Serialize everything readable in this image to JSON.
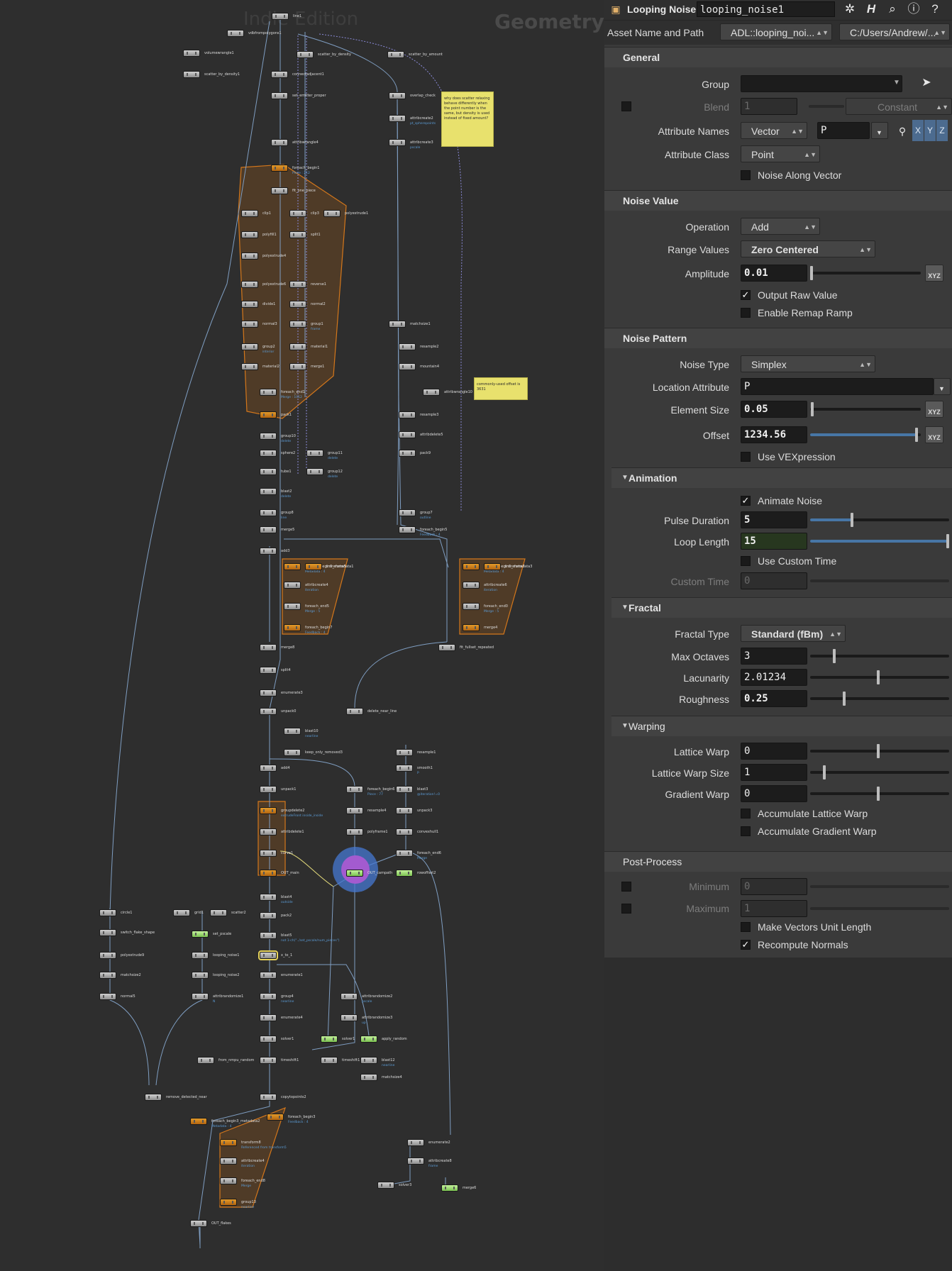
{
  "network": {
    "context_label": "Indie Edition",
    "geometry_label": "Geometry",
    "sticky_notes": [
      "why does scatter relaxing behave differently when the point number is the same, but density is used instead of fixed amount?",
      "commonly-used offset is 3631"
    ],
    "nodes": [
      {
        "label": "line1",
        "sub": ""
      },
      {
        "label": "vdbfrompolygons1",
        "sub": ""
      },
      {
        "label": "volumewrangle1",
        "sub": ""
      },
      {
        "label": "scatter_by_density1",
        "sub": ""
      },
      {
        "label": "scatter_by_density",
        "sub": ""
      },
      {
        "label": "scatter_by_amount",
        "sub": ""
      },
      {
        "label": "connectadjacent1",
        "sub": ""
      },
      {
        "label": "set_emitter_proper",
        "sub": ""
      },
      {
        "label": "overlap_check",
        "sub": ""
      },
      {
        "label": "attribcreate2",
        "sub": "pt_spherepoints"
      },
      {
        "label": "attribcreate3",
        "sub": "pscale"
      },
      {
        "label": "attribwrangle4",
        "sub": ""
      },
      {
        "label": "foreach_begin1",
        "sub": "Piece : 212"
      },
      {
        "label": "fit_one_piece",
        "sub": ""
      },
      {
        "label": "clip1",
        "sub": ""
      },
      {
        "label": "clip3",
        "sub": ""
      },
      {
        "label": "polyextrude1",
        "sub": ""
      },
      {
        "label": "polyfill1",
        "sub": ""
      },
      {
        "label": "split1",
        "sub": ""
      },
      {
        "label": "polyextrude4",
        "sub": ""
      },
      {
        "label": "polyextrude6",
        "sub": ""
      },
      {
        "label": "reverse1",
        "sub": ""
      },
      {
        "label": "divide1",
        "sub": ""
      },
      {
        "label": "normal2",
        "sub": ""
      },
      {
        "label": "normal3",
        "sub": ""
      },
      {
        "label": "group1",
        "sub": "frame"
      },
      {
        "label": "group2",
        "sub": "interior"
      },
      {
        "label": "material1",
        "sub": ""
      },
      {
        "label": "material2",
        "sub": ""
      },
      {
        "label": "merge1",
        "sub": ""
      },
      {
        "label": "foreach_end1",
        "sub": "Merge : 1012"
      },
      {
        "label": "pack1",
        "sub": ""
      },
      {
        "label": "group10",
        "sub": "delete"
      },
      {
        "label": "sphere2",
        "sub": ""
      },
      {
        "label": "group11",
        "sub": "delete"
      },
      {
        "label": "tube1",
        "sub": ""
      },
      {
        "label": "group12",
        "sub": "delete"
      },
      {
        "label": "blast2",
        "sub": "delete"
      },
      {
        "label": "group8",
        "sub": "line"
      },
      {
        "label": "merge5",
        "sub": ""
      },
      {
        "label": "add3",
        "sub": ""
      },
      {
        "label": "matchsize1",
        "sub": ""
      },
      {
        "label": "resample2",
        "sub": ""
      },
      {
        "label": "mountain4",
        "sub": ""
      },
      {
        "label": "attribwrangle10",
        "sub": ""
      },
      {
        "label": "resample3",
        "sub": ""
      },
      {
        "label": "attribdelete5",
        "sub": ""
      },
      {
        "label": "pack9",
        "sub": ""
      },
      {
        "label": "group7",
        "sub": "outline"
      },
      {
        "label": "foreach_begin5",
        "sub": "Feedback : 4"
      },
      {
        "label": "foreach_begin5_metadata1",
        "sub": "Metadata : 4"
      },
      {
        "label": "transform5",
        "sub": ""
      },
      {
        "label": "attribcreate4",
        "sub": "iteration"
      },
      {
        "label": "foreach_end5",
        "sub": "Merge : 5"
      },
      {
        "label": "foreach_begin7",
        "sub": "Feedback : 4"
      },
      {
        "label": "foreach_begin5_metadata3",
        "sub": "Metadata : 4"
      },
      {
        "label": "transform7",
        "sub": ""
      },
      {
        "label": "attribcreate6",
        "sub": "iteration"
      },
      {
        "label": "foreach_end0",
        "sub": "Merge : 5"
      },
      {
        "label": "merge4",
        "sub": ""
      },
      {
        "label": "merge8",
        "sub": ""
      },
      {
        "label": "fit_fullset_repeated",
        "sub": ""
      },
      {
        "label": "split4",
        "sub": ""
      },
      {
        "label": "enumerate3",
        "sub": ""
      },
      {
        "label": "unpack0",
        "sub": ""
      },
      {
        "label": "delete_near_line",
        "sub": ""
      },
      {
        "label": "blast10",
        "sub": "nearline"
      },
      {
        "label": "keep_only_removed3",
        "sub": ""
      },
      {
        "label": "add4",
        "sub": ""
      },
      {
        "label": "resample1",
        "sub": ""
      },
      {
        "label": "smooth1",
        "sub": "P"
      },
      {
        "label": "blast3",
        "sub": "@iteration!=0"
      },
      {
        "label": "unpack1",
        "sub": ""
      },
      {
        "label": "foreach_begin6",
        "sub": "Piece : 77"
      },
      {
        "label": "groupdelete2",
        "sub": "extrudeFront inside_inside"
      },
      {
        "label": "resample4",
        "sub": ""
      },
      {
        "label": "unpack3",
        "sub": ""
      },
      {
        "label": "attribdelete1",
        "sub": ""
      },
      {
        "label": "polyframe1",
        "sub": ""
      },
      {
        "label": "convexhull1",
        "sub": ""
      },
      {
        "label": "curve1",
        "sub": ""
      },
      {
        "label": "foreach_end6",
        "sub": "Merge"
      },
      {
        "label": "OUT_main",
        "sub": ""
      },
      {
        "label": "OUT_campath",
        "sub": ""
      },
      {
        "label": "rowoffset2",
        "sub": ""
      },
      {
        "label": "blast4",
        "sub": "outside"
      },
      {
        "label": "circle1",
        "sub": ""
      },
      {
        "label": "grid1",
        "sub": ""
      },
      {
        "label": "scatter2",
        "sub": ""
      },
      {
        "label": "pack2",
        "sub": ""
      },
      {
        "label": "switch_flake_shape",
        "sub": ""
      },
      {
        "label": "set_pscale",
        "sub": ""
      },
      {
        "label": "blast5",
        "sub": "not 1-ch(\"../set_pscale/num_pieces\")"
      },
      {
        "label": "polyextrude9",
        "sub": ""
      },
      {
        "label": "looping_noise1",
        "sub": ""
      },
      {
        "label": "x_to_1",
        "sub": ""
      },
      {
        "label": "matchsize2",
        "sub": ""
      },
      {
        "label": "looping_noise2",
        "sub": ""
      },
      {
        "label": "enumerate1",
        "sub": ""
      },
      {
        "label": "normal5",
        "sub": ""
      },
      {
        "label": "attribrandomize1",
        "sub": "N"
      },
      {
        "label": "group4",
        "sub": "nearline"
      },
      {
        "label": "attribrandomize2",
        "sub": "pscale"
      },
      {
        "label": "enumerate4",
        "sub": ""
      },
      {
        "label": "attribrandomize3",
        "sub": "up"
      },
      {
        "label": "solver1",
        "sub": ""
      },
      {
        "label": "solver1",
        "sub": ""
      },
      {
        "label": "apply_random",
        "sub": ""
      },
      {
        "label": "from_nmpu_random",
        "sub": ""
      },
      {
        "label": "timeshift1",
        "sub": ""
      },
      {
        "label": "timeshift1",
        "sub": ""
      },
      {
        "label": "blast12",
        "sub": "nearline"
      },
      {
        "label": "matchsize4",
        "sub": ""
      },
      {
        "label": "remove_detected_near",
        "sub": ""
      },
      {
        "label": "copytopoints2",
        "sub": ""
      },
      {
        "label": "foreach_begin3_metadata2",
        "sub": "Metadata : 4"
      },
      {
        "label": "foreach_begin3",
        "sub": "Feedback : 4"
      },
      {
        "label": "transform8",
        "sub": "Referenced from transform5"
      },
      {
        "label": "attribcreate4",
        "sub": "iteration"
      },
      {
        "label": "foreach_end8",
        "sub": "Merge"
      },
      {
        "label": "group13",
        "sub": "nearline"
      },
      {
        "label": "enumerate2",
        "sub": ""
      },
      {
        "label": "attribcreate8",
        "sub": "frame"
      },
      {
        "label": "solver3",
        "sub": ""
      },
      {
        "label": "merge6",
        "sub": ""
      },
      {
        "label": "OUT_flakes",
        "sub": ""
      }
    ]
  },
  "panel": {
    "node_type": "Looping Noise",
    "node_name": "looping_noise1",
    "asset_label": "Asset Name and Path",
    "asset_name": "ADL::looping_noi...",
    "asset_path": "C:/Users/Andrew/...",
    "icons": [
      "gear-icon",
      "houdini-h-icon",
      "search-icon",
      "info-icon",
      "help-icon"
    ],
    "sections": {
      "general": "General",
      "noise_value": "Noise Value",
      "noise_pattern": "Noise Pattern",
      "animation": "Animation",
      "fractal": "Fractal",
      "warping": "Warping",
      "post_process": "Post-Process"
    },
    "general": {
      "group_label": "Group",
      "group_value": "",
      "blend_label": "Blend",
      "blend_value": "1",
      "blend_mode": "Constant",
      "attr_names_label": "Attribute Names",
      "attr_type": "Vector",
      "attr_name": "P",
      "axes": [
        "X",
        "Y",
        "Z"
      ],
      "attr_class_label": "Attribute Class",
      "attr_class": "Point",
      "noise_along_vector_label": "Noise Along Vector",
      "noise_along_vector": false
    },
    "noise_value": {
      "operation_label": "Operation",
      "operation": "Add",
      "range_label": "Range Values",
      "range": "Zero Centered",
      "amplitude_label": "Amplitude",
      "amplitude": "0.01",
      "output_raw_label": "Output Raw Value",
      "output_raw": true,
      "enable_remap_label": "Enable Remap Ramp",
      "enable_remap": false
    },
    "noise_pattern": {
      "noise_type_label": "Noise Type",
      "noise_type": "Simplex",
      "location_attr_label": "Location Attribute",
      "location_attr": "P",
      "element_size_label": "Element Size",
      "element_size": "0.05",
      "offset_label": "Offset",
      "offset": "1234.56",
      "use_vexpr_label": "Use VEXpression",
      "use_vexpr": false
    },
    "animation": {
      "animate_label": "Animate Noise",
      "animate": true,
      "pulse_label": "Pulse Duration",
      "pulse": "5",
      "pulse_level": 0.3,
      "loop_label": "Loop Length",
      "loop": "15",
      "loop_level": 1.0,
      "custom_time_toggle_label": "Use Custom Time",
      "custom_time_toggle": false,
      "custom_time_label": "Custom Time",
      "custom_time": "0"
    },
    "fractal": {
      "type_label": "Fractal Type",
      "type": "Standard (fBm)",
      "octaves_label": "Max Octaves",
      "octaves": "3",
      "lacunarity_label": "Lacunarity",
      "lacunarity": "2.01234",
      "roughness_label": "Roughness",
      "roughness": "0.25"
    },
    "warping": {
      "lattice_label": "Lattice Warp",
      "lattice": "0",
      "lattice_size_label": "Lattice Warp Size",
      "lattice_size": "1",
      "gradient_label": "Gradient Warp",
      "gradient": "0",
      "acc_lattice_label": "Accumulate Lattice Warp",
      "acc_gradient_label": "Accumulate Gradient Warp"
    },
    "post_process": {
      "min_label": "Minimum",
      "min": "0",
      "max_label": "Maximum",
      "max": "1",
      "unit_length_label": "Make Vectors Unit Length",
      "unit_length": false,
      "recompute_label": "Recompute Normals",
      "recompute": true
    }
  }
}
